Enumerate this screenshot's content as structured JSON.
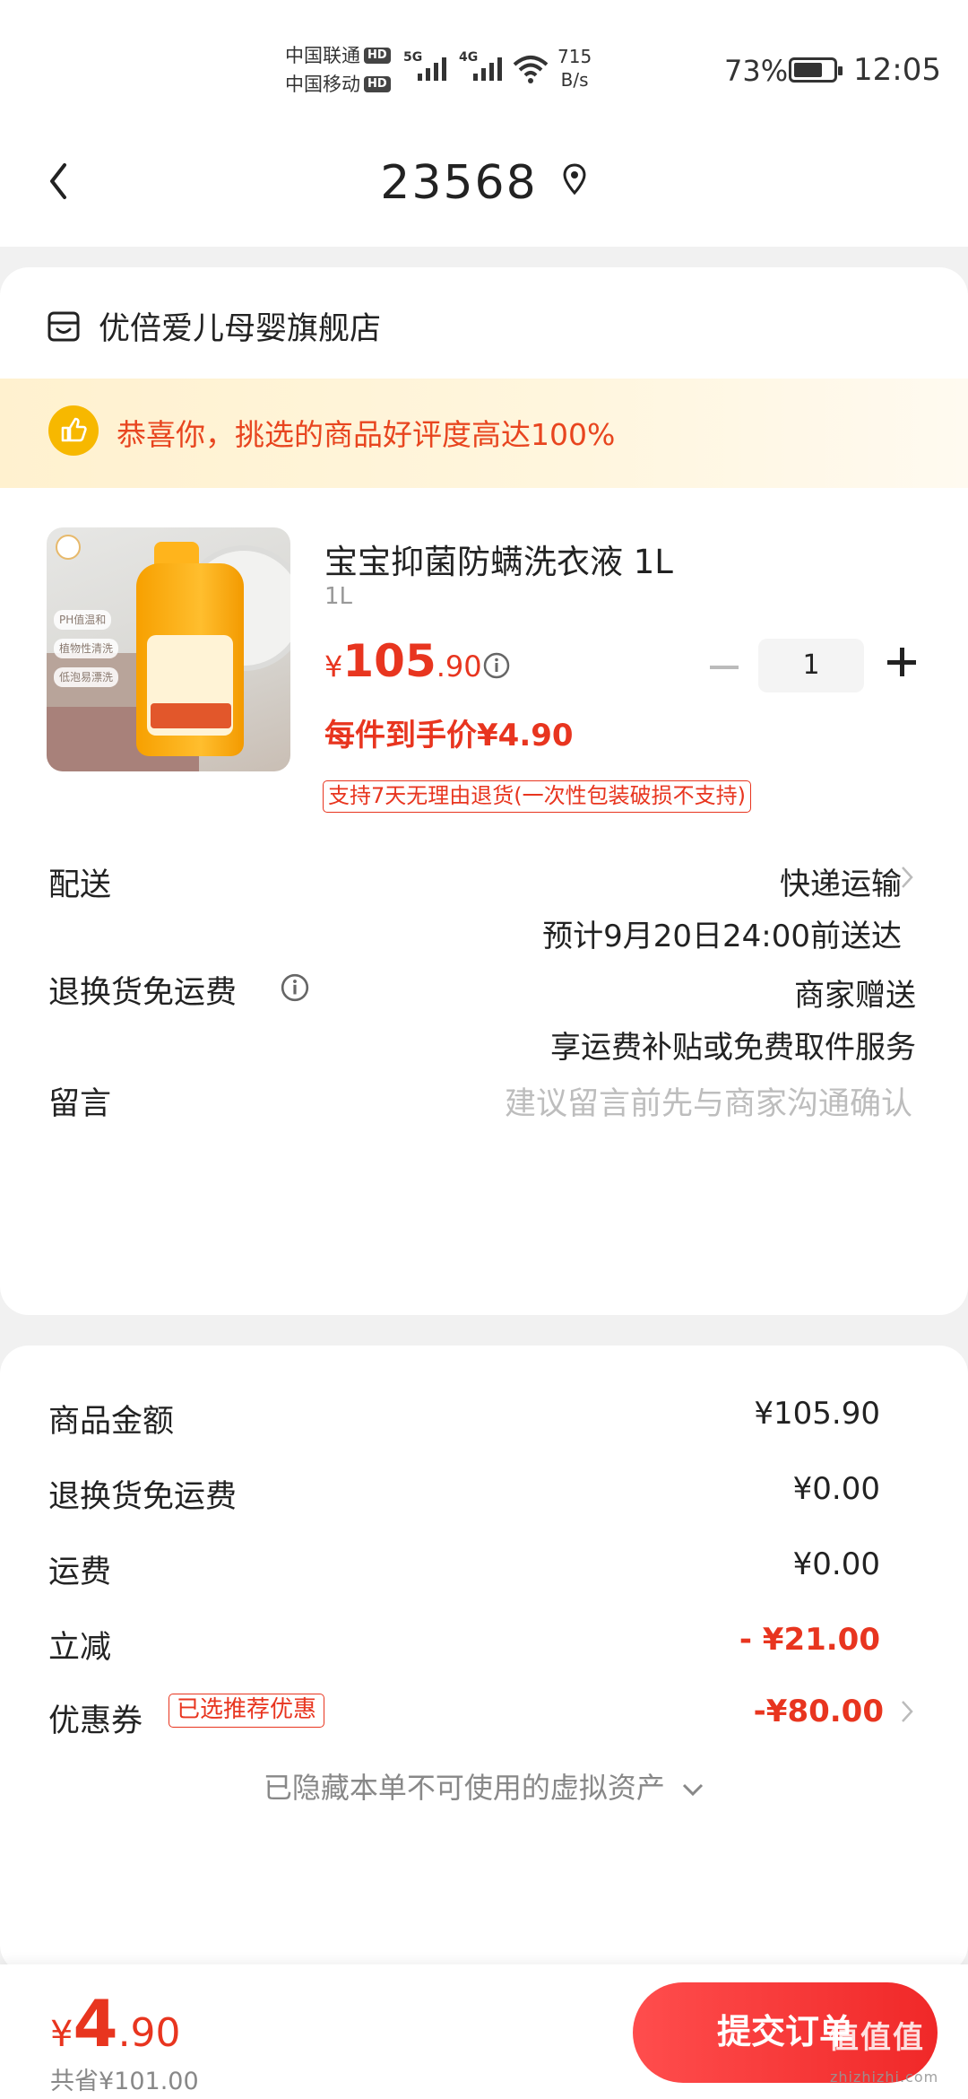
{
  "status_bar": {
    "carrier1": "中国联通",
    "carrier2": "中国移动",
    "hd": "HD",
    "net1": "5G",
    "net2": "4G",
    "speed_value": "715",
    "speed_unit": "B/s",
    "battery_percent": "73%",
    "battery_level": 0.73,
    "time": "12:05"
  },
  "header": {
    "title": "23568",
    "back_icon": "chevron-left-icon",
    "location_icon": "location-pin-icon"
  },
  "store": {
    "name": "优倍爱儿母婴旗舰店",
    "icon": "store-icon"
  },
  "banner": {
    "text": "恭喜你，挑选的商品好评度高达100%",
    "icon": "thumbs-up-icon",
    "icon_bg": "#f7b800"
  },
  "product": {
    "title": "宝宝抑菌防螨洗衣液 1L",
    "spec": "1L",
    "price_currency": "¥",
    "price_int": "105",
    "price_dec": ".90",
    "quantity": "1",
    "unit_price_text": "每件到手价¥4.90",
    "return_policy": "支持7天无理由退货(一次性包装破损不支持)",
    "image_tags": [
      "PH值温和",
      "植物性清洗",
      "低泡易漂洗"
    ]
  },
  "delivery": {
    "label": "配送",
    "method": "快递运输",
    "eta": "预计9月20日24:00前送达"
  },
  "return_shipping": {
    "label": "退换货免运费",
    "value": "商家赠送",
    "desc": "享运费补贴或免费取件服务"
  },
  "remark": {
    "label": "留言",
    "placeholder": "建议留言前先与商家沟通确认"
  },
  "summary": {
    "goods_label": "商品金额",
    "goods_value": "¥105.90",
    "return_fee_label": "退换货免运费",
    "return_fee_value": "¥0.00",
    "shipping_label": "运费",
    "shipping_value": "¥0.00",
    "discount_label": "立减",
    "discount_value": "- ¥21.00",
    "coupon_label": "优惠券",
    "coupon_tag": "已选推荐优惠",
    "coupon_value": "-¥80.00",
    "hidden_note": "已隐藏本单不可使用的虚拟资产"
  },
  "footer": {
    "total_currency": "¥",
    "total_int": "4",
    "total_dec": ".90",
    "saved": "共省¥101.00",
    "submit_label": "提交订单",
    "watermark": "值值值",
    "watermark_sub": "zhizhizhi.com"
  },
  "colors": {
    "accent_red": "#e8351f",
    "banner_bg": "#fff1cf",
    "page_bg": "#f1f1f1"
  }
}
